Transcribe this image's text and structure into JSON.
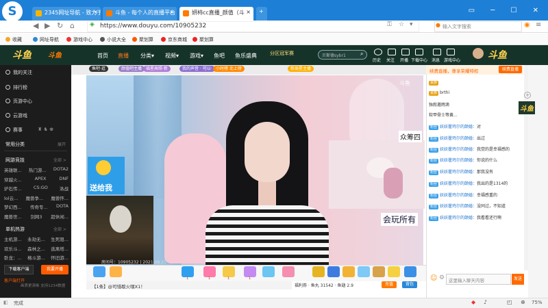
{
  "browser": {
    "logo": "S",
    "tabs": [
      {
        "label": "2345网址导航 - 致力于"
      },
      {
        "label": "斗鱼 - 每个人的直播平台"
      },
      {
        "label": "妍柿cc直播_颜值（斗"
      }
    ],
    "tab_close": "×",
    "window_controls": "▭ ─ ☐ ✕",
    "url": "https://www.douyu.com/10905232",
    "search_placeholder": "输入文字搜索",
    "bookmarks": [
      "收藏",
      "网址导航",
      "游戏中心",
      "小说大全",
      "聚划算",
      "京东商城",
      "聚划算"
    ],
    "status_text": "完成",
    "zoom": "75%"
  },
  "douyu": {
    "brand_art": "斗鱼",
    "nav": [
      "首页",
      "直播",
      "分类▾",
      "视频▾",
      "游戏▾",
      "鱼吧",
      "鱼乐盛典"
    ],
    "promo": "分区冠军赛",
    "search_value": "贝斯德sybr1",
    "top_icons": [
      "历史",
      "关注",
      "开播",
      "下载中心",
      "消息",
      "游戏中心"
    ]
  },
  "sidebar": {
    "items": [
      "我的关注",
      "排行榜",
      "页游中心",
      "云游戏",
      "赛事"
    ],
    "sections": [
      {
        "title": "常用分类",
        "more": "展开",
        "rows": []
      },
      {
        "title": "网游竞技",
        "more": "全部 >",
        "rows": [
          [
            "英雄联...",
            "热门游...",
            "DOTA2"
          ],
          [
            "穿越火...",
            "APEX",
            "DNF"
          ],
          [
            "炉石传...",
            "CS:GO",
            "洛战"
          ],
          [
            "lol云...",
            "魔兽争...",
            "魔兽怀..."
          ],
          [
            "梦幻西...",
            "传奇专...",
            "DOTA"
          ],
          [
            "魔兽世...",
            "剑网3",
            "超休闲..."
          ]
        ]
      },
      {
        "title": "单机热游",
        "more": "全部 >",
        "rows": [
          [
            "主机游...",
            "永劫无...",
            "生死阻..."
          ],
          [
            "欢乐斗...",
            "森林之...",
            "逃离塔..."
          ],
          [
            "卧龙：...",
            "格斗游...",
            "怀旧游..."
          ]
        ]
      }
    ],
    "btn_download": "下载客户端",
    "btn_open": "我要开播",
    "footer": "客户端打开",
    "footer_note": "画质更清晰 支持1234数据"
  },
  "room": {
    "chips": [
      "鱼吧·逛",
      "颜值吧主播",
      "福星高照·新",
      "我的声音 · 可以·",
      "小时榜 北上榜",
      "新周星主播"
    ],
    "watermark": "斗鱼",
    "overlay_top": "众筹四",
    "overlay_bottom": "会玩所有",
    "promo_text": "送给我",
    "room_id": "房间号：10905232 | 2021.08.21",
    "ticker": "【1条】@可惜歇火嘿X1！",
    "gift_labels": [
      "1",
      "1",
      "1",
      "1"
    ],
    "gift_info": "福利券 · 鱼丸 31542 · 鱼翅 2.9",
    "recharge": "充值",
    "bag": "背包"
  },
  "chat": {
    "header": "续费直播，尊享荣耀特权",
    "header_btn": "续费直播",
    "messages": [
      {
        "badge": "贵族",
        "user": "",
        "text": ""
      },
      {
        "badge": "贵族",
        "user": "",
        "text": "brthi"
      },
      {
        "badge": "",
        "user": "",
        "text": "独叙邀雨滴"
      },
      {
        "badge": "",
        "user": "",
        "text": "软甲骨士等黄..."
      },
      {
        "badge": "粉丝",
        "user": "妖妖瞿鸡尔的颠婚：",
        "text": "对"
      },
      {
        "badge": "粉丝",
        "user": "妖妖瞿鸡尔的颠婚：",
        "text": "出过"
      },
      {
        "badge": "粉丝",
        "user": "妖妖瞿鸡尔的颠婚：",
        "text": "我觉的是幸福感的"
      },
      {
        "badge": "粉丝",
        "user": "妖妖瞿鸡尔的颠婚：",
        "text": "你说的什么"
      },
      {
        "badge": "粉丝",
        "user": "妖妖瞿鸡尔的颠婚：",
        "text": "那我没有"
      },
      {
        "badge": "粉丝",
        "user": "妖妖瞿鸡尔的颠婚：",
        "text": "我出的是1314的"
      },
      {
        "badge": "粉丝",
        "user": "妖妖瞿鸡尔的颠婚：",
        "text": "幸福感重的"
      },
      {
        "badge": "粉丝",
        "user": "妖妖瞿鸡尔的颠婚：",
        "text": "没同过，不知道"
      },
      {
        "badge": "粉丝",
        "user": "妖妖瞿鸡尔的颠婚：",
        "text": "我看看还行啊"
      }
    ],
    "input_placeholder": "这里输入聊天内容",
    "send": "发送"
  },
  "colors": {
    "accent": "#ff6a00",
    "browser_blue": "#1e7fd6",
    "douyu_header": "#16332a"
  }
}
